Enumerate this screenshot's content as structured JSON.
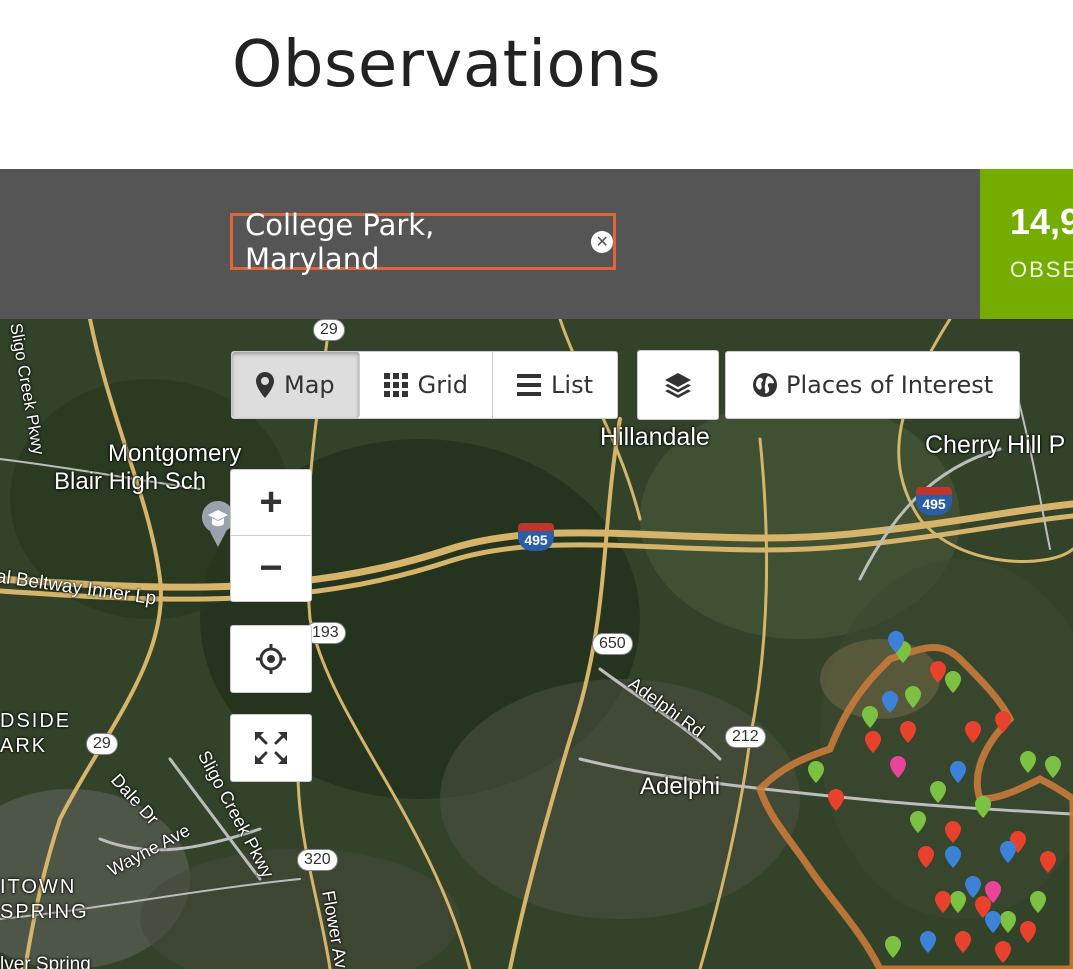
{
  "page": {
    "title": "Observations"
  },
  "filter": {
    "place": "College Park, Maryland",
    "remove_icon": "times-circle-icon"
  },
  "stats": {
    "count": "14,9",
    "label": "OBSE"
  },
  "view_tabs": [
    {
      "label": "Map",
      "icon": "map-marker-icon",
      "active": true
    },
    {
      "label": "Grid",
      "icon": "grid-icon",
      "active": false
    },
    {
      "label": "List",
      "icon": "list-icon",
      "active": false
    }
  ],
  "layers_icon": "layers-icon",
  "places_of_interest": {
    "label": "Places of Interest",
    "icon": "globe-icon"
  },
  "map_controls": {
    "zoom_in": "+",
    "zoom_out": "−",
    "locate_icon": "crosshair-icon",
    "fullscreen_icon": "expand-icon"
  },
  "map_labels": {
    "places": [
      "Hillandale",
      "Cherry Hill P",
      "Montgomery",
      "Blair High Sch",
      "Adelphi",
      "DSIDE",
      "ARK",
      "ITOWN",
      "SPRING"
    ],
    "roads": [
      "Sligo Creek Pkwy",
      "tal Beltway Inner Lp",
      "Adelphi Rd",
      "Dale Dr",
      "Sligo Creek Pkwy",
      "Wayne Ave",
      "Flower Av",
      "lver Spring"
    ],
    "route_shields": [
      "29",
      "193",
      "650",
      "212",
      "29",
      "320"
    ],
    "interstate_shields": [
      "495",
      "495"
    ]
  },
  "colors": {
    "accent_orange": "#e2643a",
    "inat_green": "#74ac00",
    "filter_bar": "#555555",
    "boundary": "#c97a3a",
    "marker_green": "#7cc242",
    "marker_red": "#e8412c",
    "marker_blue": "#3b82d8",
    "marker_pink": "#e8449a"
  }
}
